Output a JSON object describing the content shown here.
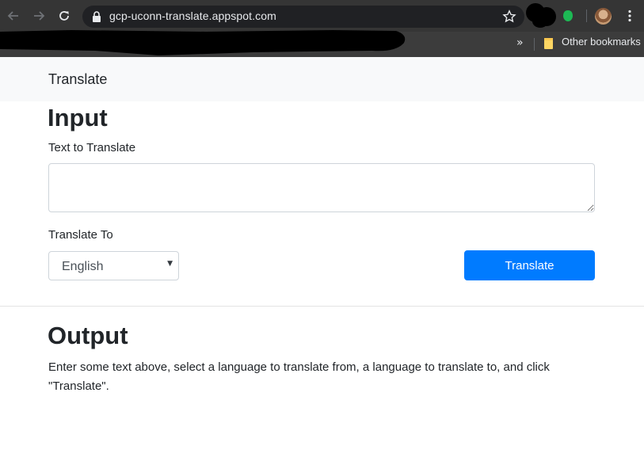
{
  "browser": {
    "url": "gcp-uconn-translate.appspot.com",
    "bookmarks_more": "»",
    "other_bookmarks": "Other bookmarks",
    "icons": [
      "back-icon",
      "forward-icon",
      "reload-icon",
      "lock-icon",
      "star-icon",
      "menu-icon",
      "folder-icon"
    ],
    "colors": {
      "toolbar": "#353535",
      "omnibox": "#202124",
      "extension_green": "#1db954"
    }
  },
  "navbar": {
    "brand": "Translate"
  },
  "input_section": {
    "heading": "Input",
    "text_label": "Text to Translate",
    "text_value": "",
    "target_label": "Translate To",
    "target_selected": "English",
    "submit_label": "Translate"
  },
  "output_section": {
    "heading": "Output",
    "message": "Enter some text above, select a language to translate from, a language to translate to, and click \"Translate\"."
  },
  "theme": {
    "primary": "#007bff",
    "navbar_bg": "#f8f9fa",
    "text": "#212529"
  }
}
